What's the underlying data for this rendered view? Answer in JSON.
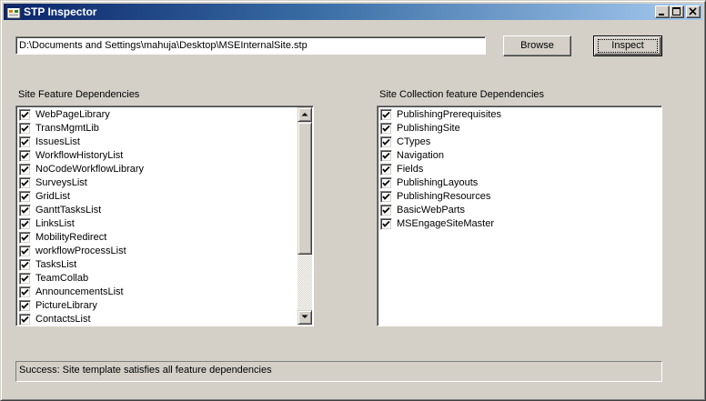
{
  "window": {
    "title": "STP Inspector",
    "title_icon": "app-form-icon",
    "caption_buttons": [
      "minimize",
      "maximize",
      "close"
    ]
  },
  "file_path": {
    "value": "D:\\Documents and Settings\\mahuja\\Desktop\\MSEInternalSite.stp"
  },
  "buttons": {
    "browse": "Browse",
    "inspect": "Inspect"
  },
  "site_features": {
    "label": "Site Feature Dependencies",
    "items": [
      {
        "label": "WebPageLibrary",
        "checked": true
      },
      {
        "label": "TransMgmtLib",
        "checked": true
      },
      {
        "label": "IssuesList",
        "checked": true
      },
      {
        "label": "WorkflowHistoryList",
        "checked": true
      },
      {
        "label": "NoCodeWorkflowLibrary",
        "checked": true
      },
      {
        "label": "SurveysList",
        "checked": true
      },
      {
        "label": "GridList",
        "checked": true
      },
      {
        "label": "GanttTasksList",
        "checked": true
      },
      {
        "label": "LinksList",
        "checked": true
      },
      {
        "label": "MobilityRedirect",
        "checked": true
      },
      {
        "label": "workflowProcessList",
        "checked": true
      },
      {
        "label": "TasksList",
        "checked": true
      },
      {
        "label": "TeamCollab",
        "checked": true
      },
      {
        "label": "AnnouncementsList",
        "checked": true
      },
      {
        "label": "PictureLibrary",
        "checked": true
      },
      {
        "label": "ContactsList",
        "checked": true
      }
    ]
  },
  "collection_features": {
    "label": "Site Collection feature Dependencies",
    "items": [
      {
        "label": "PublishingPrerequisites",
        "checked": true
      },
      {
        "label": "PublishingSite",
        "checked": true
      },
      {
        "label": "CTypes",
        "checked": true
      },
      {
        "label": "Navigation",
        "checked": true
      },
      {
        "label": "Fields",
        "checked": true
      },
      {
        "label": "PublishingLayouts",
        "checked": true
      },
      {
        "label": "PublishingResources",
        "checked": true
      },
      {
        "label": "BasicWebParts",
        "checked": true
      },
      {
        "label": "MSEngageSiteMaster",
        "checked": true
      }
    ]
  },
  "status": {
    "message": "Success: Site template satisfies all feature dependencies"
  }
}
